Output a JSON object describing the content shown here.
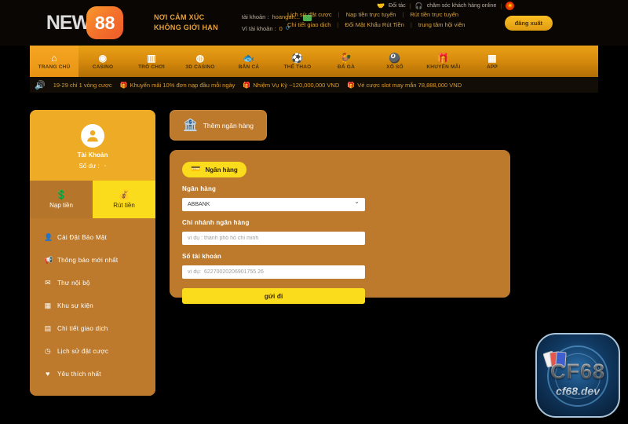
{
  "header": {
    "logo_text": "NEW",
    "logo_badge": "88",
    "slogan_line1": "NƠI CẢM XÚC",
    "slogan_line2": "KHÔNG GIỚI HẠN",
    "account_label": "tài khoản :",
    "account_value": "hoangan...",
    "wallet_label": "Ví tài khoản :",
    "wallet_value": "0",
    "message_icon": "message-badge-icon",
    "refresh_icon": "refresh-icon",
    "links": [
      "Lịch sử đặt cược",
      "Nạp tiền trực tuyến",
      "Rút tiền trực tuyến",
      "Chi tiết giao dịch",
      "Đổi Mật Khẩu Rút Tiền",
      "trung tâm hội viên"
    ],
    "separator": "|",
    "partner_label": "Đối tác",
    "partner_icon": "handshake-icon",
    "support_label": "chăm sóc khách hàng online",
    "support_icon": "headset-icon",
    "flag_icon": "vietnam-flag-icon",
    "logout_label": "đăng xuất"
  },
  "nav": {
    "items": [
      {
        "label": "TRANG CHỦ",
        "icon": "home-icon",
        "glyph": "⌂",
        "active": true
      },
      {
        "label": "CASINO",
        "icon": "chip-icon",
        "glyph": "◉",
        "active": false
      },
      {
        "label": "TRÒ CHƠI",
        "icon": "slot-machine-icon",
        "glyph": "▥",
        "active": false
      },
      {
        "label": "3D CASINO",
        "icon": "dice-icon",
        "glyph": "◍",
        "active": false
      },
      {
        "label": "BẮN CÁ",
        "icon": "fish-icon",
        "glyph": "🐟",
        "active": false
      },
      {
        "label": "THỂ THAO",
        "icon": "soccer-ball-icon",
        "glyph": "⚽",
        "active": false
      },
      {
        "label": "ĐÁ GÀ",
        "icon": "rooster-icon",
        "glyph": "🐓",
        "active": false
      },
      {
        "label": "XỔ SỐ",
        "icon": "lottery-balls-icon",
        "glyph": "🎱",
        "active": false
      },
      {
        "label": "KHUYẾN MÃI",
        "icon": "gift-icon",
        "glyph": "🎁",
        "active": false
      },
      {
        "label": "APP",
        "icon": "grid-apps-icon",
        "glyph": "▦",
        "active": false
      }
    ]
  },
  "marquee": {
    "speaker_icon": "speaker-icon",
    "items": [
      "19-29 chỉ 1 vòng cược",
      "Khuyến mãi 10% đơn nạp đầu mỗi ngày",
      "Nhiệm Vụ Kỳ ~120,000,000 VND",
      "Vé cược slot may mắn 78,888,000 VND"
    ]
  },
  "sidebar": {
    "avatar_icon": "user-avatar-icon",
    "account_title": "Tài Khoản",
    "balance_label": "Số dư :",
    "balance_icon": "coin-icon",
    "tabs": [
      {
        "label": "Nạp tiền",
        "icon": "deposit-money-icon",
        "glyph": "◉",
        "active": false
      },
      {
        "label": "Rút tiền",
        "icon": "withdraw-hand-icon",
        "glyph": "✋",
        "active": true
      }
    ],
    "menu": [
      {
        "label": "Cài Đặt Bảo Mật",
        "icon": "user-shield-icon",
        "glyph": "👤"
      },
      {
        "label": "Thông báo mới nhất",
        "icon": "megaphone-icon",
        "glyph": "📢"
      },
      {
        "label": "Thư nội bộ",
        "icon": "envelope-icon",
        "glyph": "✉"
      },
      {
        "label": "Khu sự kiện",
        "icon": "calendar-icon",
        "glyph": "▦"
      },
      {
        "label": "Chi tiết giao dịch",
        "icon": "clipboard-icon",
        "glyph": "▤"
      },
      {
        "label": "Lịch sử đặt cược",
        "icon": "clock-icon",
        "glyph": "◷"
      },
      {
        "label": "Yêu thích nhất",
        "icon": "heart-icon",
        "glyph": "♥"
      }
    ]
  },
  "main": {
    "add_bank_label": "Thêm ngân hàng",
    "add_bank_icon": "bank-add-icon",
    "tab_label": "Ngân hàng",
    "tab_icon": "credit-card-icon",
    "bank_label": "Ngân hàng",
    "bank_value": "ABBANK",
    "bank_options": [
      "ABBANK"
    ],
    "chevron_icon": "chevron-down-icon",
    "branch_label": "Chi nhánh ngân hàng",
    "branch_placeholder": "ví dụ : thành phố hồ chí minh",
    "branch_value": "",
    "account_number_label": "Số tài khoản",
    "account_number_placeholder": "ví dụ:  62270020206901755 26",
    "account_number_value": "",
    "submit_label": "gửi đi"
  },
  "watermark": {
    "title": "CF68",
    "subtitle": "cf68.dev"
  },
  "colors": {
    "brand_orange": "#e8a117",
    "panel_brown": "#bd7a2c",
    "accent_yellow": "#fbdc1d",
    "card_gold": "#eeab25",
    "background": "#000000",
    "link_gold": "#d8a33f"
  }
}
